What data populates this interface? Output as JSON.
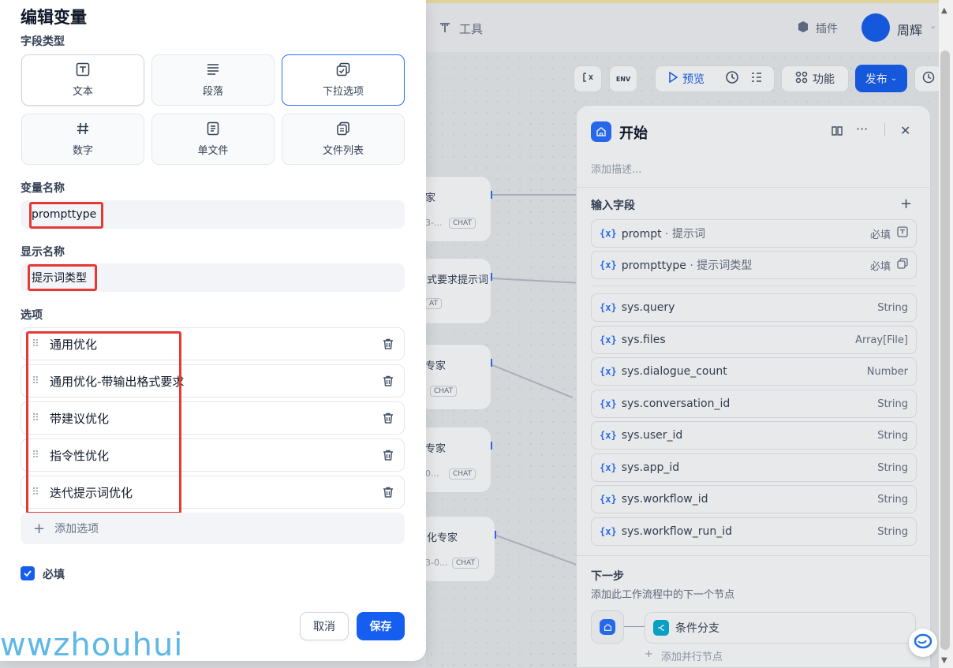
{
  "header": {
    "tools_label": "工具",
    "plugins_label": "插件",
    "user_name": "周辉"
  },
  "toolbar": {
    "preview_label": "预览",
    "features_label": "功能",
    "publish_label": "发布",
    "env_label": "ENV"
  },
  "canvas": {
    "nodes": [
      {
        "title": "家",
        "meta": "3-...",
        "tag": "CHAT"
      },
      {
        "title": "式要求提示词",
        "meta": "AT",
        "tag": ""
      },
      {
        "title": "专家",
        "meta": "",
        "tag": "CHAT"
      },
      {
        "title": "专家",
        "meta": "0...",
        "tag": "CHAT"
      },
      {
        "title": "化专家",
        "meta": "3-0...",
        "tag": "CHAT"
      }
    ]
  },
  "start_panel": {
    "title": "开始",
    "description_placeholder": "添加描述...",
    "inputs_title": "输入字段",
    "inputs": [
      {
        "name": "prompt",
        "label": "提示词",
        "right": "必填"
      },
      {
        "name": "prompttype",
        "label": "提示词类型",
        "right": "必填"
      }
    ],
    "system_vars": [
      {
        "name": "sys.query",
        "type": "String"
      },
      {
        "name": "sys.files",
        "type": "Array[File]"
      },
      {
        "name": "sys.dialogue_count",
        "type": "Number"
      },
      {
        "name": "sys.conversation_id",
        "type": "String"
      },
      {
        "name": "sys.user_id",
        "type": "String"
      },
      {
        "name": "sys.app_id",
        "type": "String"
      },
      {
        "name": "sys.workflow_id",
        "type": "String"
      },
      {
        "name": "sys.workflow_run_id",
        "type": "String"
      }
    ],
    "var_prefix": "{x}",
    "next_title": "下一步",
    "next_desc": "添加此工作流程中的下一个节点",
    "next_node": "条件分支",
    "add_parallel": "添加并行节点"
  },
  "modal": {
    "title": "编辑变量",
    "field_type_label": "字段类型",
    "types": [
      {
        "label": "文本",
        "icon": "text-icon"
      },
      {
        "label": "段落",
        "icon": "paragraph-icon"
      },
      {
        "label": "下拉选项",
        "icon": "select-icon"
      },
      {
        "label": "数字",
        "icon": "hash-icon"
      },
      {
        "label": "单文件",
        "icon": "file-icon"
      },
      {
        "label": "文件列表",
        "icon": "file-list-icon"
      }
    ],
    "selected_type": "下拉选项",
    "var_name_label": "变量名称",
    "var_name_value": "prompttype",
    "display_name_label": "显示名称",
    "display_name_value": "提示词类型",
    "options_label": "选项",
    "options": [
      "通用优化",
      "通用优化-带输出格式要求",
      "带建议优化",
      "指令性优化",
      "迭代提示词优化"
    ],
    "add_option_label": "添加选项",
    "required_label": "必填",
    "required_checked": true,
    "cancel_label": "取消",
    "save_label": "保存"
  },
  "watermark": "wwzhouhui",
  "colors": {
    "primary": "#155eef",
    "highlight_red": "#e53935",
    "var_blue": "#2970ff"
  }
}
